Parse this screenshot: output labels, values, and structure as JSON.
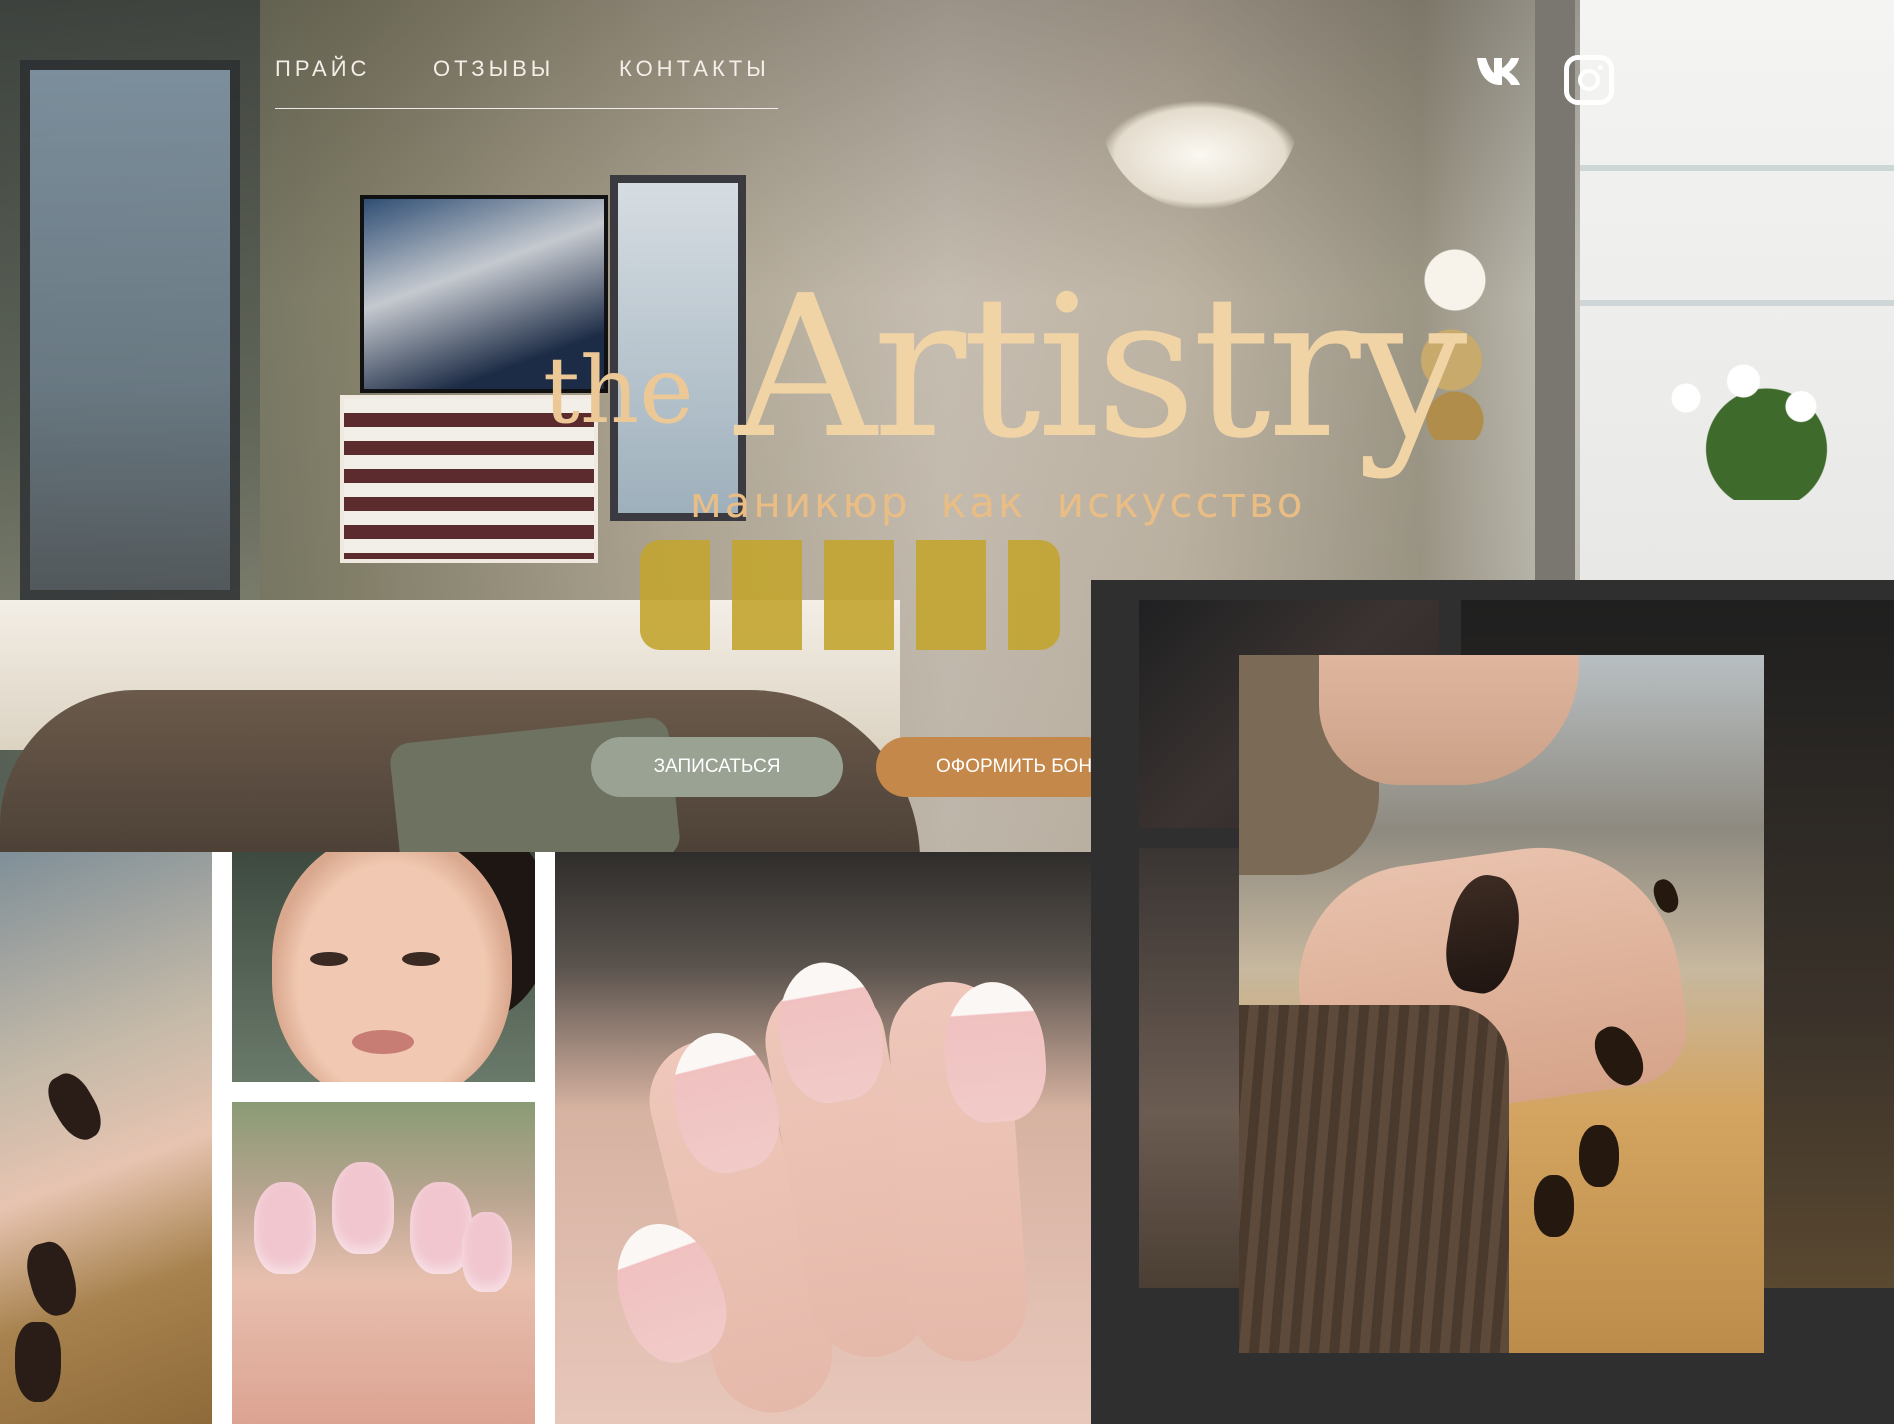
{
  "nav": {
    "items": [
      {
        "label": "ПРАЙС"
      },
      {
        "label": "ОТЗЫВЫ"
      },
      {
        "label": "КОНТАКТЫ"
      }
    ]
  },
  "social": {
    "vk_icon": "vk-icon",
    "instagram_icon": "instagram-icon"
  },
  "hero": {
    "logo_prefix": "the",
    "logo_main": "Artistry",
    "tagline": "маникюр как искусство",
    "book_button": "ЗАПИСАТЬСЯ",
    "gift_button": "ОФОРМИТЬ БОНУС"
  },
  "colors": {
    "accent_gold": "#e9bd84",
    "book_button_bg": "#9aa393",
    "gift_button_bg": "#c5884b",
    "lightbox_bg": "#2f2f2f"
  }
}
